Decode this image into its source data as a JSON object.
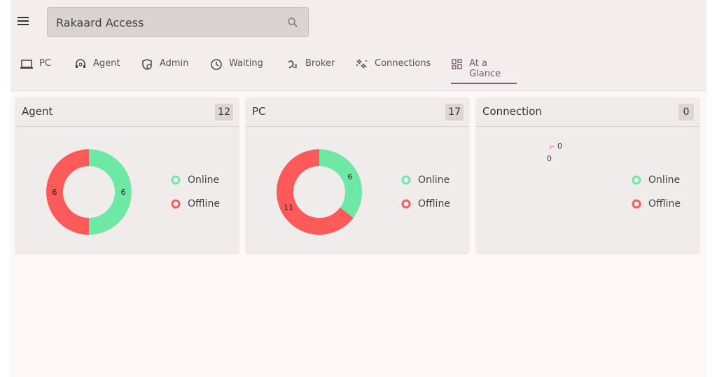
{
  "search": {
    "value": "Rakaard Access"
  },
  "tabs": [
    {
      "label": "PC",
      "icon": "laptop-icon"
    },
    {
      "label": "Agent",
      "icon": "headset-icon"
    },
    {
      "label": "Admin",
      "icon": "admin-icon"
    },
    {
      "label": "Waiting",
      "icon": "clock-icon"
    },
    {
      "label": "Broker",
      "icon": "broker-icon"
    },
    {
      "label": "Connections",
      "icon": "connections-icon"
    },
    {
      "label": "At a Glance",
      "icon": "dashboard-icon",
      "active": true
    }
  ],
  "colors": {
    "online": "#6ee9a5",
    "offline": "#ff5a5a",
    "accent": "#8a5d76"
  },
  "cards": [
    {
      "title": "Agent",
      "count": "12",
      "legend": {
        "online": "Online",
        "offline": "Offline"
      }
    },
    {
      "title": "PC",
      "count": "17",
      "legend": {
        "online": "Online",
        "offline": "Offline"
      }
    },
    {
      "title": "Connection",
      "count": "0",
      "legend": {
        "online": "Online",
        "offline": "Offline"
      }
    }
  ],
  "chart_data": [
    {
      "type": "pie",
      "categories": [
        "Online",
        "Offline"
      ],
      "values": [
        6,
        6
      ],
      "labels": [
        "6",
        "6"
      ]
    },
    {
      "type": "pie",
      "categories": [
        "Online",
        "Offline"
      ],
      "values": [
        6,
        11
      ],
      "labels": [
        "6",
        "11"
      ]
    },
    {
      "type": "pie",
      "categories": [
        "Online",
        "Offline"
      ],
      "values": [
        0,
        0
      ],
      "labels": [
        "0",
        "0"
      ]
    }
  ]
}
